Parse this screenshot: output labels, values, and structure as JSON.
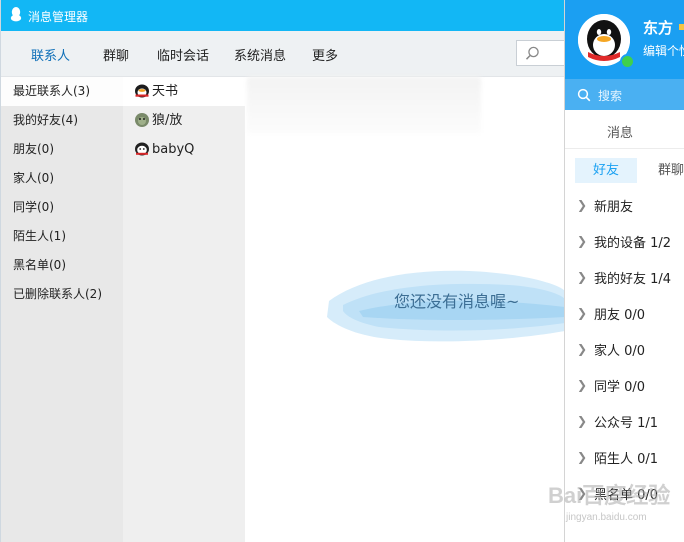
{
  "message_manager": {
    "title": "消息管理器",
    "nav_tabs": [
      {
        "label": "联系人",
        "active": true
      },
      {
        "label": "群聊"
      },
      {
        "label": "临时会话"
      },
      {
        "label": "系统消息"
      },
      {
        "label": "更多"
      }
    ],
    "groups": [
      {
        "label": "最近联系人(3)",
        "selected": true
      },
      {
        "label": "我的好友(4)"
      },
      {
        "label": "朋友(0)"
      },
      {
        "label": "家人(0)"
      },
      {
        "label": "同学(0)"
      },
      {
        "label": "陌生人(1)"
      },
      {
        "label": "黑名单(0)"
      },
      {
        "label": "已删除联系人(2)"
      }
    ],
    "contacts": [
      {
        "name": "天书",
        "avatar": "penguin-avatar-icon",
        "selected": true
      },
      {
        "name": "狼/放",
        "avatar": "wolf-avatar-icon"
      },
      {
        "name": "babyQ",
        "avatar": "babyq-avatar-icon"
      }
    ],
    "empty_message": "您还没有消息喔~"
  },
  "qq_panel": {
    "nickname": "东方",
    "signature": "编辑个性签名",
    "search_placeholder": "搜索",
    "message_tab": "消息",
    "segments": {
      "friends": "好友",
      "groups": "群聊"
    },
    "friend_groups": [
      {
        "label": "新朋友"
      },
      {
        "label": "我的设备 1/2"
      },
      {
        "label": "我的好友 1/4"
      },
      {
        "label": "朋友 0/0"
      },
      {
        "label": "家人 0/0"
      },
      {
        "label": "同学 0/0"
      },
      {
        "label": "公众号 1/1"
      },
      {
        "label": "陌生人 0/1"
      },
      {
        "label": "黑名单 0/0"
      }
    ]
  },
  "watermark": {
    "text": "Bai百度经验",
    "url": "jingyan.baidu.com"
  },
  "colors": {
    "accent": "#12b7f5",
    "panel_header": "#1b9ff2",
    "active_tab": "#0e6fb8"
  }
}
